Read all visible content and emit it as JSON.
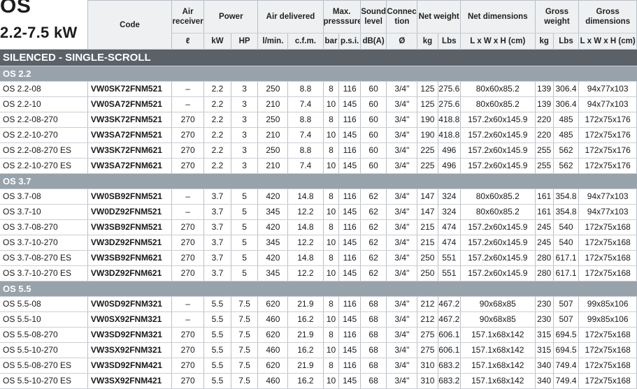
{
  "title": "OS",
  "subtitle": "2.2-7.5 kW",
  "headers": {
    "code": "Code",
    "air_receiver": "Air receiver",
    "power": "Power",
    "air_delivered": "Air delivered",
    "max_pressure": "Max. presssure",
    "sound_level": "Sound level",
    "connection": "Connec- tion",
    "net_weight": "Net weight",
    "net_dimensions": "Net dimensions",
    "gross_weight": "Gross weight",
    "gross_dimensions": "Gross dimensions"
  },
  "units": [
    "ℓ",
    "kW",
    "HP",
    "l/min.",
    "c.f.m.",
    "bar",
    "p.s.i.",
    "dB(A)",
    "Ø",
    "kg",
    "Lbs",
    "L x W x H (cm)",
    "kg",
    "Lbs",
    "L x W x H (cm)"
  ],
  "banner": "SILENCED - SINGLE-SCROLL",
  "groups": [
    {
      "name": "OS 2.2",
      "rows": [
        [
          "OS 2.2-08",
          "VW0SK72FNM521",
          "–",
          "2.2",
          "3",
          "250",
          "8.8",
          "8",
          "116",
          "60",
          "3/4\"",
          "125",
          "275.6",
          "80x60x85.2",
          "139",
          "306.4",
          "94x77x103"
        ],
        [
          "OS 2.2-10",
          "VW0SA72FNM521",
          "–",
          "2.2",
          "3",
          "210",
          "7.4",
          "10",
          "145",
          "60",
          "3/4\"",
          "125",
          "275.6",
          "80x60x85.2",
          "139",
          "306.4",
          "94x77x103"
        ],
        [
          "OS 2.2-08-270",
          "VW3SK72FNM521",
          "270",
          "2.2",
          "3",
          "250",
          "8.8",
          "8",
          "116",
          "60",
          "3/4\"",
          "190",
          "418.8",
          "157.2x60x145.9",
          "220",
          "485",
          "172x75x176"
        ],
        [
          "OS 2.2-10-270",
          "VW3SA72FNM521",
          "270",
          "2.2",
          "3",
          "210",
          "7.4",
          "10",
          "145",
          "60",
          "3/4\"",
          "190",
          "418.8",
          "157.2x60x145.9",
          "220",
          "485",
          "172x75x176"
        ],
        [
          "OS 2.2-08-270 ES",
          "VW3SK72FNM621",
          "270",
          "2.2",
          "3",
          "250",
          "8.8",
          "8",
          "116",
          "60",
          "3/4\"",
          "225",
          "496",
          "157.2x60x145.9",
          "255",
          "562",
          "172x75x176"
        ],
        [
          "OS 2.2-10-270 ES",
          "VW3SA72FNM621",
          "270",
          "2.2",
          "3",
          "210",
          "7.4",
          "10",
          "145",
          "60",
          "3/4\"",
          "225",
          "496",
          "157.2x60x145.9",
          "255",
          "562",
          "172x75x176"
        ]
      ]
    },
    {
      "name": "OS 3.7",
      "rows": [
        [
          "OS 3.7-08",
          "VW0SB92FNM521",
          "–",
          "3.7",
          "5",
          "420",
          "14.8",
          "8",
          "116",
          "62",
          "3/4\"",
          "147",
          "324",
          "80x60x85.2",
          "161",
          "354.8",
          "94x77x103"
        ],
        [
          "OS 3.7-10",
          "VW0DZ92FNM521",
          "–",
          "3.7",
          "5",
          "345",
          "12.2",
          "10",
          "145",
          "62",
          "3/4\"",
          "147",
          "324",
          "80x60x85.2",
          "161",
          "354.8",
          "94x77x103"
        ],
        [
          "OS 3.7-08-270",
          "VW3SB92FNM521",
          "270",
          "3.7",
          "5",
          "420",
          "14.8",
          "8",
          "116",
          "62",
          "3/4\"",
          "215",
          "474",
          "157.2x60x145.9",
          "245",
          "540",
          "172x75x168"
        ],
        [
          "OS 3.7-10-270",
          "VW3DZ92FNM521",
          "270",
          "3.7",
          "5",
          "345",
          "12.2",
          "10",
          "145",
          "62",
          "3/4\"",
          "215",
          "474",
          "157.2x60x145.9",
          "245",
          "540",
          "172x75x168"
        ],
        [
          "OS 3.7-08-270 ES",
          "VW3SB92FNM621",
          "270",
          "3.7",
          "5",
          "420",
          "14.8",
          "8",
          "116",
          "62",
          "3/4\"",
          "250",
          "551",
          "157.2x60x145.9",
          "280",
          "617.1",
          "172x75x168"
        ],
        [
          "OS 3.7-10-270 ES",
          "VW3DZ92FNM621",
          "270",
          "3.7",
          "5",
          "345",
          "12.2",
          "10",
          "145",
          "62",
          "3/4\"",
          "250",
          "551",
          "157.2x60x145.9",
          "280",
          "617.1",
          "172x75x168"
        ]
      ]
    },
    {
      "name": "OS 5.5",
      "rows": [
        [
          "OS 5.5-08",
          "VW0SD92FNM321",
          "–",
          "5.5",
          "7.5",
          "620",
          "21.9",
          "8",
          "116",
          "68",
          "3/4\"",
          "212",
          "467.2",
          "90x68x85",
          "230",
          "507",
          "99x85x106"
        ],
        [
          "OS 5.5-10",
          "VW0SX92FNM321",
          "–",
          "5.5",
          "7.5",
          "460",
          "16.2",
          "10",
          "145",
          "68",
          "3/4\"",
          "212",
          "467.2",
          "90x68x85",
          "230",
          "507",
          "99x85x106"
        ],
        [
          "OS 5.5-08-270",
          "VW3SD92FNM321",
          "270",
          "5.5",
          "7.5",
          "620",
          "21.9",
          "8",
          "116",
          "68",
          "3/4\"",
          "275",
          "606.1",
          "157.1x68x142",
          "315",
          "694.5",
          "172x75x168"
        ],
        [
          "OS 5.5-10-270",
          "VW3SX92FNM321",
          "270",
          "5.5",
          "7.5",
          "460",
          "16.2",
          "10",
          "145",
          "68",
          "3/4\"",
          "275",
          "606.1",
          "157.1x68x142",
          "315",
          "694.5",
          "172x75x168"
        ],
        [
          "OS 5.5-08-270 ES",
          "VW3SD92FNM421",
          "270",
          "5.5",
          "7.5",
          "620",
          "21.9",
          "8",
          "116",
          "68",
          "3/4\"",
          "310",
          "683.2",
          "157.1x68x142",
          "340",
          "749.4",
          "172x75x168"
        ],
        [
          "OS 5.5-10-270 ES",
          "VW3SX92FNM421",
          "270",
          "5.5",
          "7.5",
          "460",
          "16.2",
          "10",
          "145",
          "68",
          "3/4\"",
          "310",
          "683.2",
          "157.1x68x142",
          "340",
          "749.4",
          "172x75x168"
        ]
      ]
    }
  ],
  "colors": {
    "banner_bg": "#5a6168",
    "group_bg": "#98a2ab",
    "header_bg": "#eef0f2",
    "grid": "#b9c0c7"
  }
}
